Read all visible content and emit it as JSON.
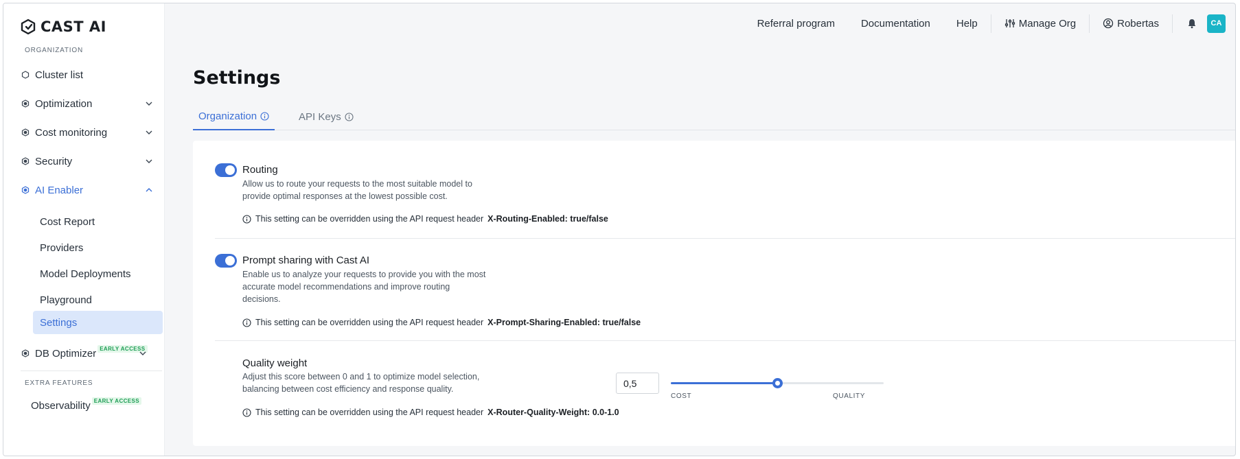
{
  "brand": {
    "name": "CAST AI"
  },
  "sidebar": {
    "section_org": "ORGANIZATION",
    "items": [
      {
        "label": "Cluster list",
        "icon": "hexagon-icon"
      },
      {
        "label": "Optimization",
        "icon": "cube-icon"
      },
      {
        "label": "Cost monitoring",
        "icon": "cube-icon"
      },
      {
        "label": "Security",
        "icon": "cube-icon"
      },
      {
        "label": "AI Enabler",
        "icon": "cube-icon",
        "expanded": true
      }
    ],
    "ai_sub": [
      {
        "label": "Cost Report"
      },
      {
        "label": "Providers"
      },
      {
        "label": "Model Deployments"
      },
      {
        "label": "Playground"
      },
      {
        "label": "Settings",
        "selected": true
      }
    ],
    "db_optimizer": {
      "label": "DB Optimizer",
      "badge": "EARLY ACCESS"
    },
    "section_extra": "EXTRA FEATURES",
    "observability": {
      "label": "Observability",
      "badge": "EARLY ACCESS"
    }
  },
  "topbar": {
    "referral": "Referral program",
    "documentation": "Documentation",
    "help": "Help",
    "manage_org": "Manage Org",
    "user": "Robertas",
    "avatar": "CA"
  },
  "page": {
    "title": "Settings",
    "tabs": [
      {
        "label": "Organization",
        "active": true
      },
      {
        "label": "API Keys",
        "active": false
      }
    ]
  },
  "settings": {
    "routing": {
      "title": "Routing",
      "desc1": "Allow us to route your requests to the most suitable model to",
      "desc2": "provide optimal responses at the lowest possible cost.",
      "note": "This setting can be overridden using the API request header",
      "header": "X-Routing-Enabled: true/false",
      "enabled": true
    },
    "prompt": {
      "title": "Prompt sharing with Cast AI",
      "desc1": "Enable us to analyze your requests to provide you with the most",
      "desc2": "accurate model recommendations and improve routing",
      "desc3": "decisions.",
      "note": "This setting can be overridden using the API request header",
      "header": "X-Prompt-Sharing-Enabled: true/false",
      "enabled": true
    },
    "quality": {
      "title": "Quality weight",
      "desc1": "Adjust this score between 0 and 1 to optimize model selection,",
      "desc2": "balancing between cost efficiency and response quality.",
      "value": "0,5",
      "slider_fraction": 0.5,
      "min_label": "COST",
      "max_label": "QUALITY",
      "note": "This setting can be overridden using the API request header",
      "header": "X-Router-Quality-Weight: 0.0-1.0"
    }
  },
  "colors": {
    "accent": "#3b6fd6",
    "badge_green": "#1e9e55",
    "avatar_bg": "#1ab4c7",
    "selected_bg": "#dbe7fb"
  }
}
